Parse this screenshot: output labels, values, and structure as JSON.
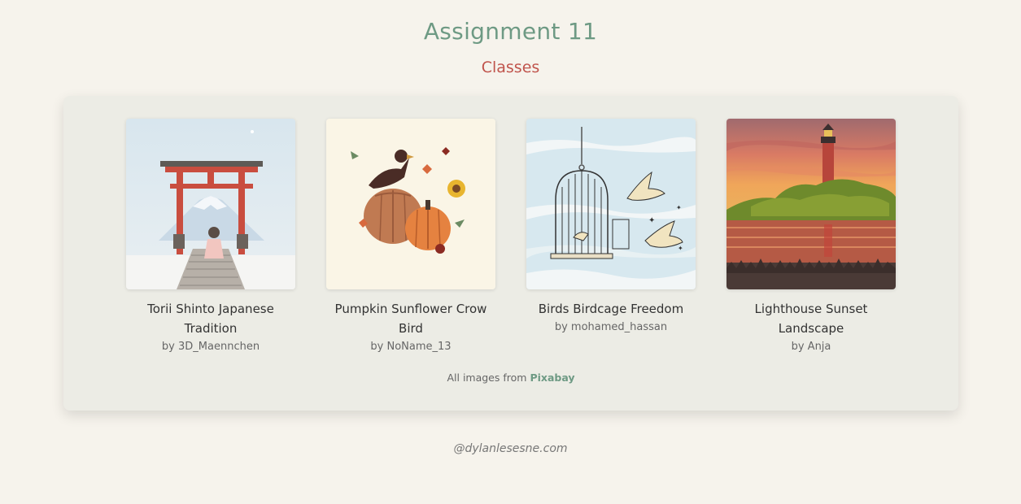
{
  "page": {
    "title": "Assignment 11",
    "subtitle": "Classes"
  },
  "gallery": {
    "items": [
      {
        "caption": "Torii Shinto Japanese Tradition",
        "author": "by 3D_Maennchen",
        "icon": "torii-gate-image"
      },
      {
        "caption": "Pumpkin Sunflower Crow Bird",
        "author": "by NoName_13",
        "icon": "pumpkin-crow-image"
      },
      {
        "caption": "Birds Birdcage Freedom",
        "author": "by mohamed_hassan",
        "icon": "birdcage-image"
      },
      {
        "caption": "Lighthouse Sunset Landscape",
        "author": "by Anja",
        "icon": "lighthouse-image"
      }
    ],
    "credit_prefix": "All images from",
    "credit_link": "Pixabay"
  },
  "footer": {
    "text": "@dylanlesesne.com"
  },
  "colors": {
    "background": "#f6f3ec",
    "card": "#ecece5",
    "title": "#6e9a84",
    "subtitle": "#c0544c",
    "link": "#6e9a84"
  }
}
